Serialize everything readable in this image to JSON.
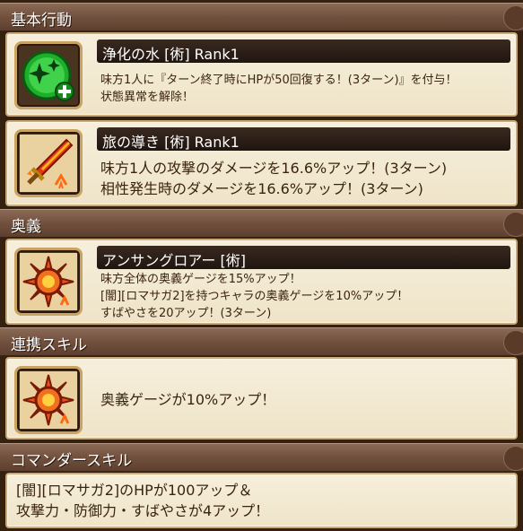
{
  "sections": {
    "basic": "基本行動",
    "ougi": "奥義",
    "renkei": "連携スキル",
    "commander": "コマンダースキル"
  },
  "skills": [
    {
      "title": "浄化の水 [術]  Rank1",
      "lines": [
        "味方1人に『ターン終了時にHPが50回復する！(3ターン)』を付与！",
        "状態異常を解除！"
      ],
      "icon": "sparkle-heal-icon"
    },
    {
      "title": "旅の導き [術]  Rank1",
      "lines": [
        "味方1人の攻撃のダメージを16.6%アップ！(3ターン)",
        "相性発生時のダメージを16.6%アップ！(3ターン)"
      ],
      "icon": "flaming-sword-icon"
    }
  ],
  "ougi": {
    "title": "アンサングロアー [術]",
    "lines": [
      "味方全体の奥義ゲージを15%アップ！",
      "[闇][ロマサガ2]を持つキャラの奥義ゲージを10%アップ！",
      "すばやさを20アップ！(3ターン)"
    ],
    "icon": "sun-burst-icon"
  },
  "renkei": {
    "text": "奥義ゲージが10%アップ！",
    "icon": "sun-burst-icon"
  },
  "commander": {
    "lines": [
      "[闇][ロマサガ2]のHPが100アップ＆",
      "攻撃力・防御力・すばやさが4アップ！"
    ]
  },
  "colors": {
    "header": "#6f4f3c",
    "card": "#f3ead2",
    "title_bar": "#2a1d16"
  }
}
